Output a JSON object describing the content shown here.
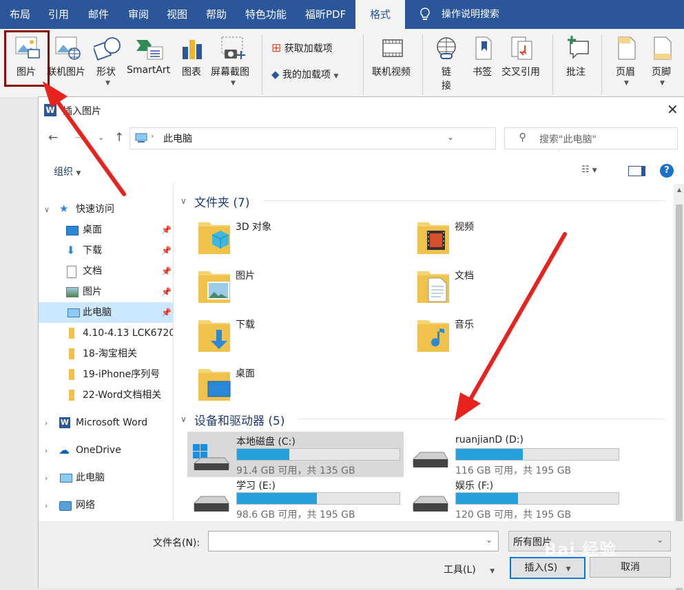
{
  "ribbon": {
    "tabs": [
      "布局",
      "引用",
      "邮件",
      "审阅",
      "视图",
      "帮助",
      "特色功能",
      "福昕PDF",
      "格式"
    ],
    "tell_me": "操作说明搜索",
    "buttons": {
      "picture": "图片",
      "online_picture": "联机图片",
      "shapes": "形状",
      "smartart": "SmartArt",
      "chart": "图表",
      "screenshot": "屏幕截图",
      "get_addins": "获取加载项",
      "my_addins": "我的加载项",
      "online_video": "联机视频",
      "link_line1": "链",
      "link_line2": "接",
      "bookmark": "书签",
      "cross_ref": "交叉引用",
      "comment": "批注",
      "header": "页眉",
      "footer": "页脚"
    }
  },
  "dialog": {
    "title": "插入图片",
    "address": "此电脑",
    "search_placeholder": "搜索\"此电脑\"",
    "organize": "组织",
    "sidebar": {
      "quick_access": "快速访问",
      "qa_items": [
        "桌面",
        "下载",
        "文档",
        "图片",
        "此电脑"
      ],
      "folders": [
        "4.10-4.13 LCK6720",
        "18-淘宝相关",
        "19-iPhone序列号",
        "22-Word文档相关"
      ],
      "roots": [
        "Microsoft Word",
        "OneDrive",
        "此电脑",
        "网络"
      ]
    },
    "folders_section": "文件夹 (7)",
    "folders": [
      "3D 对象",
      "视频",
      "图片",
      "文档",
      "下载",
      "音乐",
      "桌面"
    ],
    "devices_section": "设备和驱动器 (5)",
    "drives": [
      {
        "name": "本地磁盘 (C:)",
        "size": "91.4 GB 可用，共 135 GB",
        "used": 0.32
      },
      {
        "name": "ruanjianD (D:)",
        "size": "116 GB 可用，共 195 GB",
        "used": 0.41
      },
      {
        "name": "学习 (E:)",
        "size": "98.6 GB 可用，共 195 GB",
        "used": 0.49
      },
      {
        "name": "娱乐 (F:)",
        "size": "120 GB 可用，共 195 GB",
        "used": 0.38
      }
    ],
    "filename_label": "文件名(N):",
    "filter": "所有图片",
    "tools": "工具(L)",
    "insert": "插入(S)",
    "cancel": "取消"
  },
  "watermark": "Bai 经验"
}
